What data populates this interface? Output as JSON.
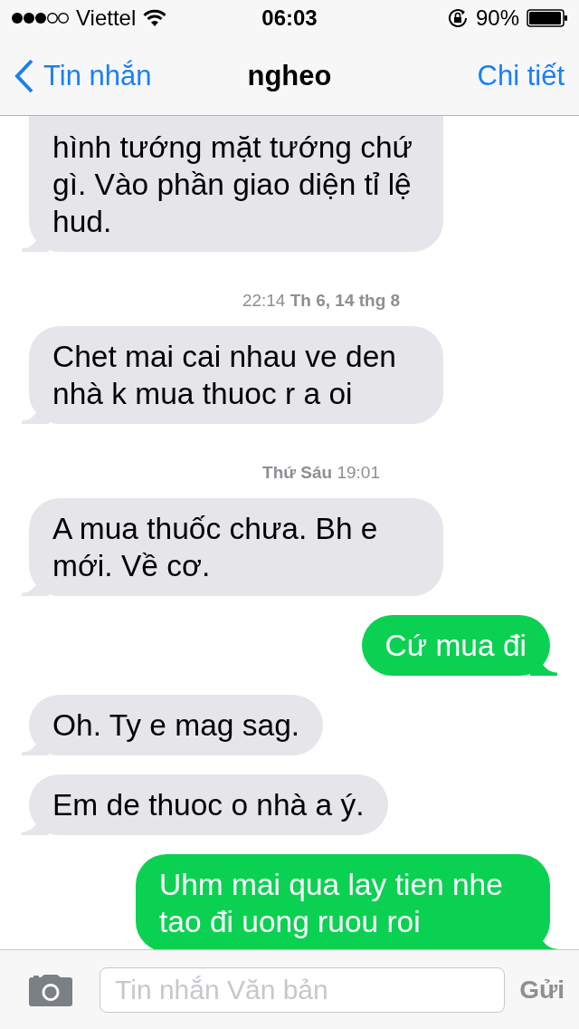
{
  "status_bar": {
    "carrier": "Viettel",
    "time": "06:03",
    "battery": "90%"
  },
  "nav": {
    "back": "Tin nhắn",
    "title": "ngheo",
    "action": "Chi tiết"
  },
  "messages": [
    {
      "kind": "received",
      "text": "hình tướng mặt tướng chứ gì. Vào phần giao diện tỉ lệ hud."
    },
    {
      "kind": "timestamp",
      "text": "22:14 **Th 6, 14 thg 8**"
    },
    {
      "kind": "received",
      "text": "Chet mai cai nhau ve den nhà k mua thuoc r a oi"
    },
    {
      "kind": "timestamp",
      "text": "**Thứ Sáu** 19:01"
    },
    {
      "kind": "received",
      "text": "A mua thuốc chưa. Bh e mới. Về cơ."
    },
    {
      "kind": "sent",
      "text": "Cứ mua đi"
    },
    {
      "kind": "received",
      "text": "Oh. Ty e mag sag."
    },
    {
      "kind": "received",
      "text": "Em de thuoc o nhà a ý."
    },
    {
      "kind": "sent",
      "text": "Uhm mai qua lay tien nhe tao đi uong ruou roi"
    }
  ],
  "composer": {
    "placeholder": "Tin nhắn Văn bản",
    "send": "Gửi"
  }
}
